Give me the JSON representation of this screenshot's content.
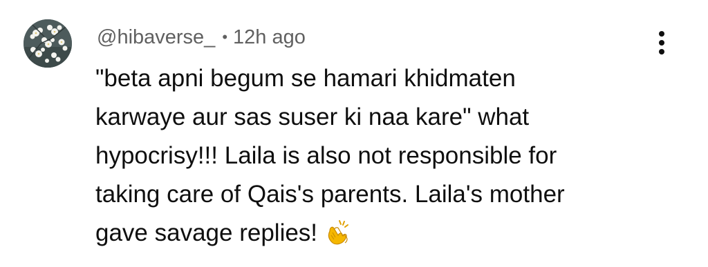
{
  "comment": {
    "author": "@hibaverse_",
    "separator": "•",
    "timestamp": "12h ago",
    "text_lines": [
      "\"beta apni begum se hamari khidmaten",
      "karwaye aur sas suser ki naa kare\" what",
      "hypocrisy!!! Laila is also not responsible for",
      "taking care of Qais's parents. Laila's mother",
      "gave savage replies!"
    ],
    "emoji": "clapping-hands-icon",
    "more_menu": "vertical-ellipsis-icon",
    "avatar": "flower-avatar"
  },
  "colors": {
    "author_text": "#606060",
    "body_text": "#0f0f0f",
    "emoji_fill": "#f5b700"
  }
}
